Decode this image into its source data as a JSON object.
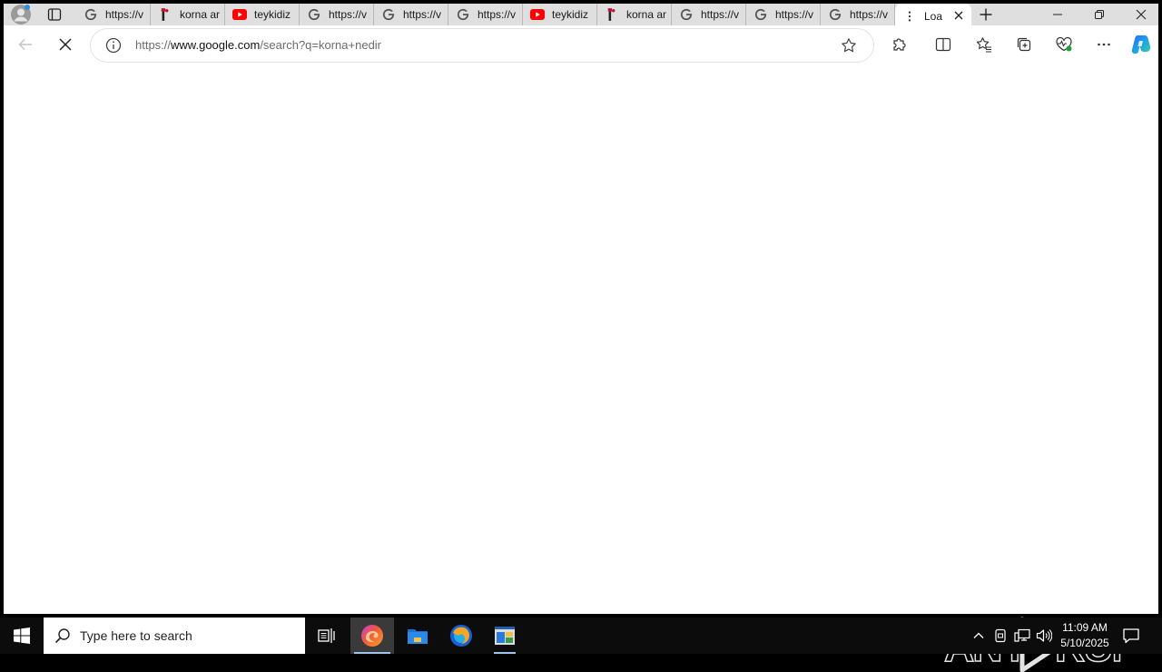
{
  "tabs": [
    {
      "label": "https://v",
      "icon": "google-icon"
    },
    {
      "label": "korna ar",
      "icon": "bookmark-favicon-icon"
    },
    {
      "label": "teykidiz",
      "icon": "youtube-icon"
    },
    {
      "label": "https://v",
      "icon": "google-icon"
    },
    {
      "label": "https://v",
      "icon": "google-icon"
    },
    {
      "label": "https://v",
      "icon": "google-icon"
    },
    {
      "label": "teykidiz",
      "icon": "youtube-icon"
    },
    {
      "label": "korna ar",
      "icon": "bookmark-favicon-icon"
    },
    {
      "label": "https://v",
      "icon": "google-icon"
    },
    {
      "label": "https://v",
      "icon": "google-icon"
    },
    {
      "label": "https://v",
      "icon": "google-icon"
    }
  ],
  "active_tab": {
    "label": "Loa",
    "icon": "loading-icon"
  },
  "address_bar": {
    "scheme": "https://",
    "host": "www.google.com",
    "path": "/search?q=korna+nedir"
  },
  "watermark": "ANY RUN",
  "taskbar": {
    "search_placeholder": "Type here to search",
    "time": "11:09 AM",
    "date": "5/10/2025"
  },
  "colors": {
    "tabstrip": "#dfdfdf",
    "taskbar": "#0c0c0c",
    "youtube_red": "#ff0000",
    "edge_blue": "#1b7fd4"
  }
}
